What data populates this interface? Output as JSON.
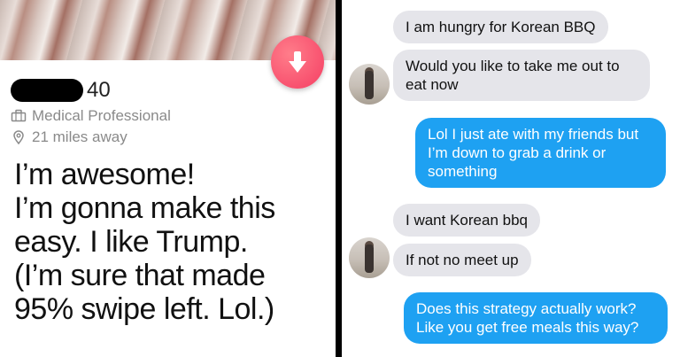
{
  "profile": {
    "age": "40",
    "job": "Medical Professional",
    "distance": "21 miles away",
    "bio_lines": [
      "I’m awesome!",
      "I’m gonna make this",
      "easy. I like Trump.",
      "(I’m sure that made",
      "95% swipe left. Lol.)"
    ],
    "icons": {
      "job": "briefcase-icon",
      "distance": "location-pin-icon",
      "swipe": "arrow-down-icon"
    },
    "accent": "#f53e63"
  },
  "chat": {
    "colors": {
      "received": "#e5e5ea",
      "sent": "#1ea1f2"
    },
    "messages": [
      {
        "from": "them",
        "text": "I am hungry for Korean BBQ"
      },
      {
        "from": "them",
        "text": "Would you like to take me out to eat now"
      },
      {
        "from": "me",
        "text": "Lol I just ate with my friends but I’m down to grab a drink or something"
      },
      {
        "from": "them",
        "text": "I want Korean bbq"
      },
      {
        "from": "them",
        "text": "If not no meet up"
      },
      {
        "from": "me",
        "text": "Does this strategy actually work? Like you get free meals this way?"
      }
    ]
  }
}
